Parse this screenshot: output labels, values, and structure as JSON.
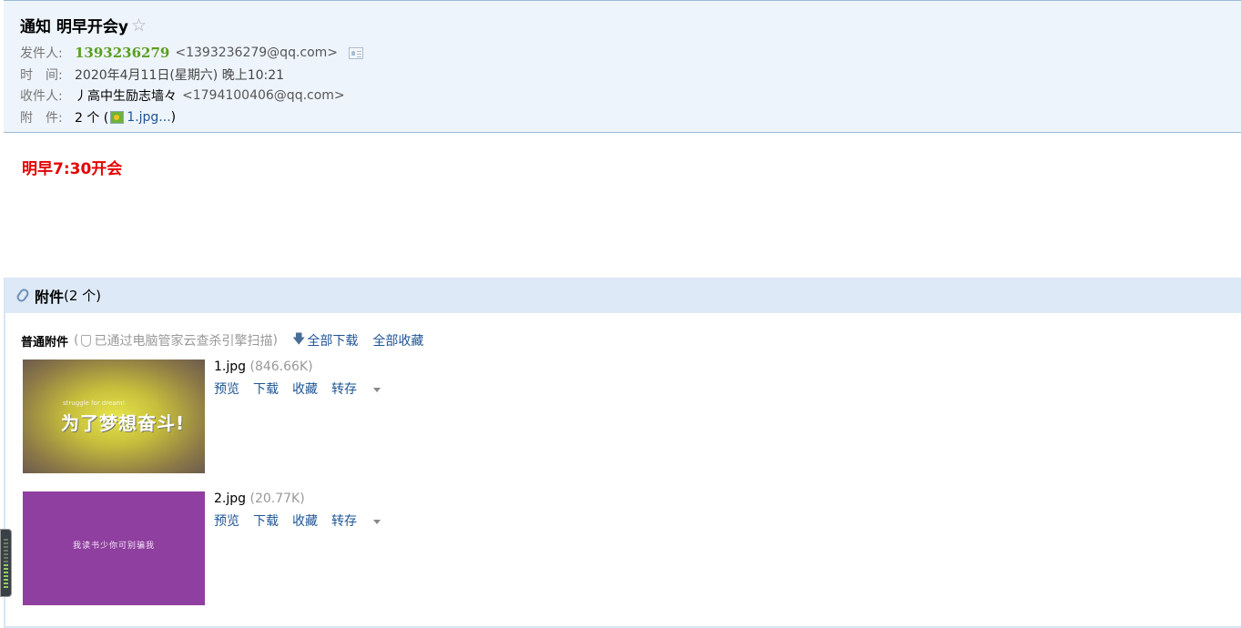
{
  "mail": {
    "subject": "通知 明早开会y",
    "star_glyph": "☆",
    "from_label": "发件人:",
    "from_name": "1393236279",
    "from_addr": "<1393236279@qq.com>",
    "time_label": "时　间:",
    "time_value": "2020年4月11日(星期六) 晚上10:21",
    "to_label": "收件人:",
    "to_name": "丿高中生励志墙々",
    "to_addr": "<1794100406@qq.com>",
    "attach_label": "附　件:",
    "attach_count": "2 个 (",
    "attach_first": "1.jpg...",
    "attach_close": ")"
  },
  "body": {
    "text": "明早7:30开会"
  },
  "attachments": {
    "title": "附件",
    "count": "(2 个)",
    "type_label": "普通附件",
    "scan_open": "(",
    "scan_text": "已通过电脑管家云查杀引擎扫描",
    "scan_close": ")",
    "download_all": "全部下载",
    "collect_all": "全部收藏",
    "items": [
      {
        "name": "1.jpg",
        "size": "(846.66K)",
        "thumb_small": "struggle for dream!",
        "thumb_text": "为了梦想奋斗!",
        "actions": [
          "预览",
          "下载",
          "收藏",
          "转存"
        ]
      },
      {
        "name": "2.jpg",
        "size": "(20.77K)",
        "thumb_text": "我读书少你可别骗我",
        "actions": [
          "预览",
          "下载",
          "收藏",
          "转存"
        ]
      }
    ]
  },
  "colors": {
    "header_bg": "#eef4fb",
    "sender": "#5a9f1e",
    "body_text": "#e60000",
    "link": "#1e5494"
  }
}
